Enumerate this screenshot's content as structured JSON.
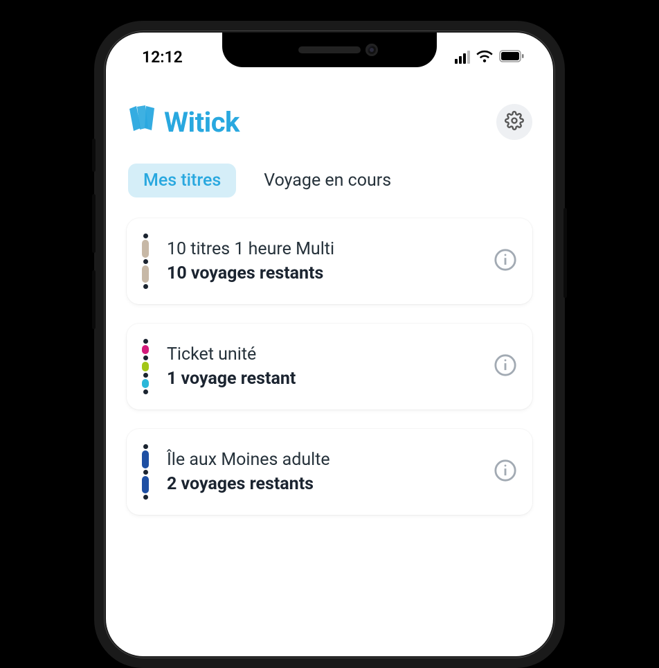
{
  "status": {
    "time": "12:12"
  },
  "brand": {
    "name": "Witick"
  },
  "tabs": [
    {
      "label": "Mes titres",
      "active": true
    },
    {
      "label": "Voyage en cours",
      "active": false
    }
  ],
  "tickets": [
    {
      "title": "10 titres 1 heure Multi",
      "subtitle": "10 voyages restants",
      "colors": [
        "#c7b8a6",
        "#c7b8a6"
      ]
    },
    {
      "title": "Ticket unité",
      "subtitle": "1 voyage restant",
      "colors": [
        "#d31b7b",
        "#a2c617",
        "#2bb7d9"
      ]
    },
    {
      "title": "Île aux Moines adulte",
      "subtitle": "2 voyages restants",
      "colors": [
        "#1e4fa3",
        "#1e4fa3"
      ]
    }
  ]
}
